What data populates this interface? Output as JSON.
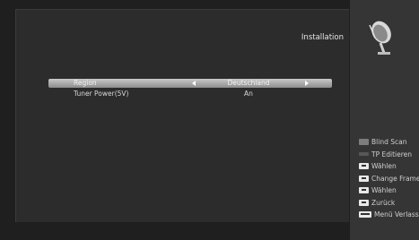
{
  "header": {
    "title": "Installation",
    "dish_icon": "satellite-dish-icon"
  },
  "menu": {
    "rows": [
      {
        "label": "Region",
        "value": "Deutschland",
        "selected": true
      },
      {
        "label": "Tuner Power(5V)",
        "value": "An",
        "selected": false
      }
    ]
  },
  "legend": [
    {
      "icon": "gray-key-icon",
      "label": "Blind Scan"
    },
    {
      "icon": "dark-key-icon",
      "label": "TP Editieren"
    },
    {
      "icon": "select-key-icon",
      "label": "Wählen"
    },
    {
      "icon": "frame-key-icon",
      "label": "Change Frame"
    },
    {
      "icon": "ok-key-icon",
      "label": "Wählen"
    },
    {
      "icon": "back-key-icon",
      "label": "Zurück"
    },
    {
      "icon": "exit-key-icon",
      "label": "Menü Verlassen"
    }
  ],
  "colors": {
    "selected_row": "#b0b0b0",
    "background": "#2c2c2c",
    "side_panel": "#353535"
  }
}
